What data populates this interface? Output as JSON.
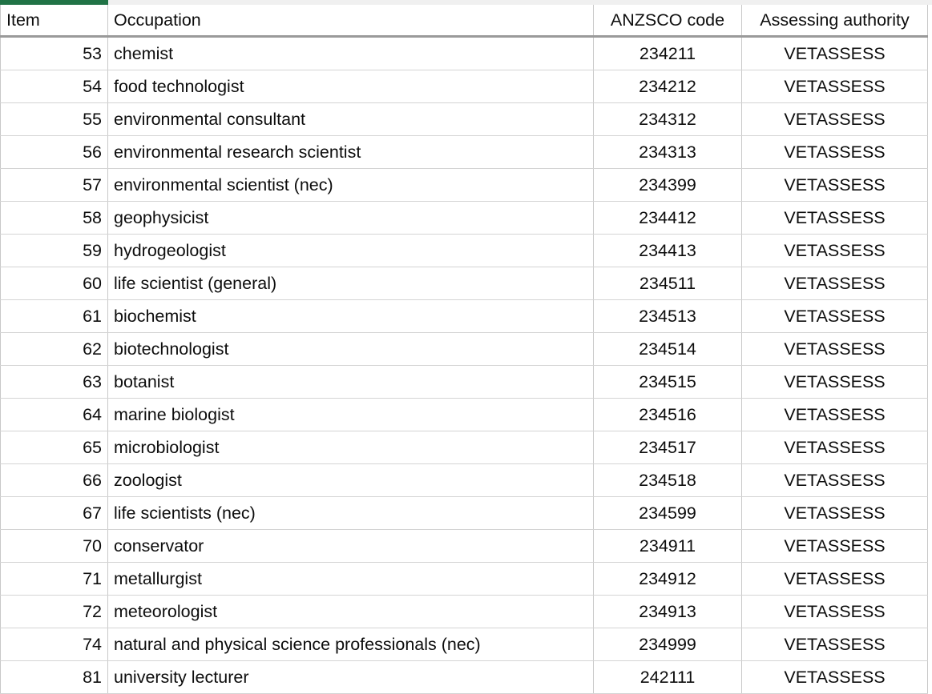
{
  "theme": {
    "accent_green": "#217346",
    "gridline": "#d4d4d4",
    "header_rule": "#9a9a9a",
    "text": "#0d0d0d",
    "background": "#ffffff"
  },
  "table": {
    "headers": {
      "item": "Item",
      "occupation": "Occupation",
      "code": "ANZSCO code",
      "authority": "Assessing authority"
    },
    "rows": [
      {
        "item": "53",
        "occupation": "chemist",
        "code": "234211",
        "authority": "VETASSESS"
      },
      {
        "item": "54",
        "occupation": "food technologist",
        "code": "234212",
        "authority": "VETASSESS"
      },
      {
        "item": "55",
        "occupation": "environmental consultant",
        "code": "234312",
        "authority": "VETASSESS"
      },
      {
        "item": "56",
        "occupation": "environmental research scientist",
        "code": "234313",
        "authority": "VETASSESS"
      },
      {
        "item": "57",
        "occupation": "environmental scientist (nec)",
        "code": "234399",
        "authority": "VETASSESS"
      },
      {
        "item": "58",
        "occupation": "geophysicist",
        "code": "234412",
        "authority": "VETASSESS"
      },
      {
        "item": "59",
        "occupation": "hydrogeologist",
        "code": "234413",
        "authority": "VETASSESS"
      },
      {
        "item": "60",
        "occupation": "life scientist (general)",
        "code": "234511",
        "authority": "VETASSESS"
      },
      {
        "item": "61",
        "occupation": "biochemist",
        "code": "234513",
        "authority": "VETASSESS"
      },
      {
        "item": "62",
        "occupation": "biotechnologist",
        "code": "234514",
        "authority": "VETASSESS"
      },
      {
        "item": "63",
        "occupation": "botanist",
        "code": "234515",
        "authority": "VETASSESS"
      },
      {
        "item": "64",
        "occupation": "marine biologist",
        "code": "234516",
        "authority": "VETASSESS"
      },
      {
        "item": "65",
        "occupation": "microbiologist",
        "code": "234517",
        "authority": "VETASSESS"
      },
      {
        "item": "66",
        "occupation": "zoologist",
        "code": "234518",
        "authority": "VETASSESS"
      },
      {
        "item": "67",
        "occupation": "life scientists (nec)",
        "code": "234599",
        "authority": "VETASSESS"
      },
      {
        "item": "70",
        "occupation": "conservator",
        "code": "234911",
        "authority": "VETASSESS"
      },
      {
        "item": "71",
        "occupation": "metallurgist",
        "code": "234912",
        "authority": "VETASSESS"
      },
      {
        "item": "72",
        "occupation": "meteorologist",
        "code": "234913",
        "authority": "VETASSESS"
      },
      {
        "item": "74",
        "occupation": "natural and physical science professionals (nec)",
        "code": "234999",
        "authority": "VETASSESS"
      },
      {
        "item": "81",
        "occupation": "university lecturer",
        "code": "242111",
        "authority": "VETASSESS"
      }
    ]
  }
}
